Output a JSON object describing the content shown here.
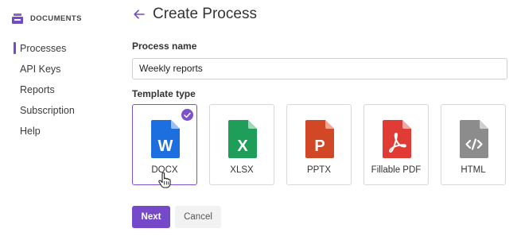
{
  "app": {
    "brand": "DOCUMENTS"
  },
  "sidebar": {
    "items": [
      {
        "label": "Processes",
        "active": true
      },
      {
        "label": "API Keys"
      },
      {
        "label": "Reports"
      },
      {
        "label": "Subscription"
      },
      {
        "label": "Help"
      }
    ]
  },
  "header": {
    "title": "Create Process"
  },
  "form": {
    "process_name_label": "Process name",
    "process_name_value": "Weekly reports",
    "template_type_label": "Template type",
    "templates": [
      {
        "label": "DOCX",
        "icon": "docx-icon",
        "color": "#1d6fe0",
        "selected": true
      },
      {
        "label": "XLSX",
        "icon": "xlsx-icon",
        "color": "#1e9e58"
      },
      {
        "label": "PPTX",
        "icon": "pptx-icon",
        "color": "#d24726"
      },
      {
        "label": "Fillable PDF",
        "icon": "pdf-icon",
        "color": "#e03b35"
      },
      {
        "label": "HTML",
        "icon": "html-icon",
        "color": "#8c8c8c"
      }
    ]
  },
  "actions": {
    "next_label": "Next",
    "cancel_label": "Cancel"
  },
  "colors": {
    "accent": "#7649c9"
  }
}
